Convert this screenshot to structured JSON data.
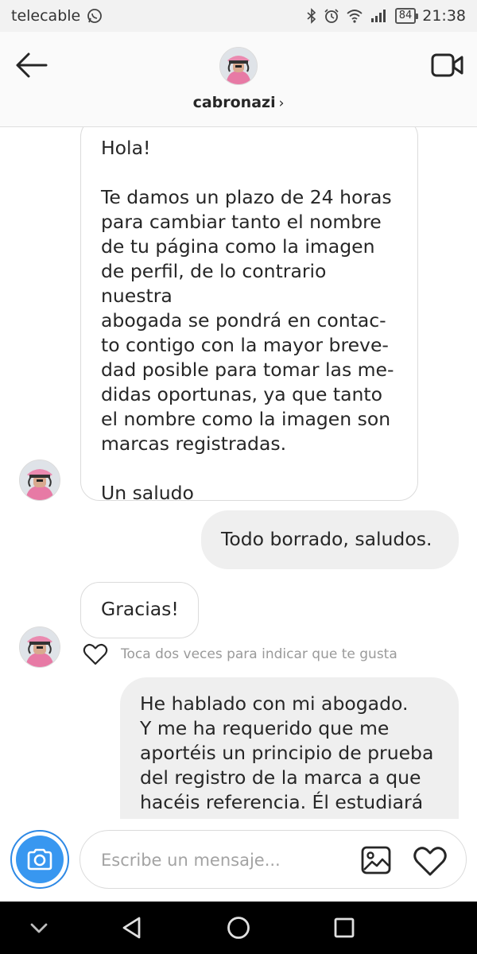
{
  "status_bar": {
    "carrier": "telecable",
    "battery": "84",
    "time": "21:38",
    "icons": [
      "whatsapp-icon",
      "bluetooth-icon",
      "alarm-icon",
      "wifi-icon",
      "signal-icon",
      "battery-icon"
    ]
  },
  "header": {
    "username": "cabronazi",
    "chevron": "›"
  },
  "messages": [
    {
      "direction": "incoming",
      "text": "Hola!\n\nTe damos un plazo de 24 horas\npara cambiar tanto el nombre\nde tu página como la imagen\nde perfil, de lo contrario nuestra\nabogada se pondrá en contac-\nto contigo con la mayor breve-\ndad posible para tomar las me-\ndidas oportunas, ya que tanto\nel nombre como la imagen son\nmarcas registradas.\n\nUn saludo"
    },
    {
      "direction": "outgoing",
      "text": "Todo borrado, saludos."
    },
    {
      "direction": "incoming",
      "text": "Gracias!"
    },
    {
      "direction": "outgoing",
      "text": "He hablado con mi abogado.\nY me ha requerido que me\naportéis un principio de prueba\ndel registro de la marca a que\nhacéis referencia. Él estudiará"
    }
  ],
  "like_hint": "Toca dos veces para indicar que te gusta",
  "composer": {
    "placeholder": "Escribe un mensaje..."
  },
  "colors": {
    "accent_blue": "#3897f0",
    "outgoing_bubble": "#efefef",
    "incoming_border": "#dbdbdb"
  }
}
